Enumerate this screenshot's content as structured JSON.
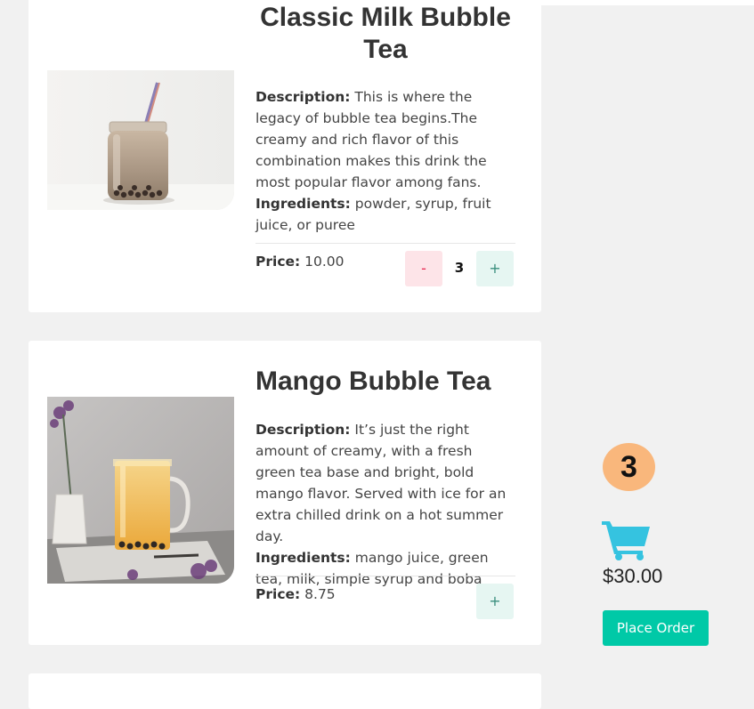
{
  "products": [
    {
      "name": "Classic Milk Bubble Tea",
      "description_label": "Description:",
      "description": "This is where the legacy of bubble tea begins.The creamy and rich flavor of this combination makes this drink the most popular flavor among fans.",
      "ingredients_label": "Ingredients:",
      "ingredients": "powder, syrup, fruit juice, or puree",
      "price_label": "Price:",
      "price": "10.00",
      "minus_label": "-",
      "quantity": "3",
      "plus_label": "+"
    },
    {
      "name": "Mango Bubble Tea",
      "description_label": "Description:",
      "description": "It’s just the right amount of creamy, with a fresh green tea base and bright, bold mango flavor. Served with ice for an extra chilled drink on a hot summer day.",
      "ingredients_label": "Ingredients:",
      "ingredients": "mango juice, green tea, milk, simple syrup and boba",
      "price_label": "Price:",
      "price": "8.75",
      "plus_label": "+"
    }
  ],
  "cart": {
    "count": "3",
    "icon": "shopping-cart-icon",
    "total": "$30.00",
    "order_label": "Place Order",
    "accent_color": "#00c9a7",
    "badge_color": "#f9b77c",
    "icon_color": "#35c3e0"
  }
}
